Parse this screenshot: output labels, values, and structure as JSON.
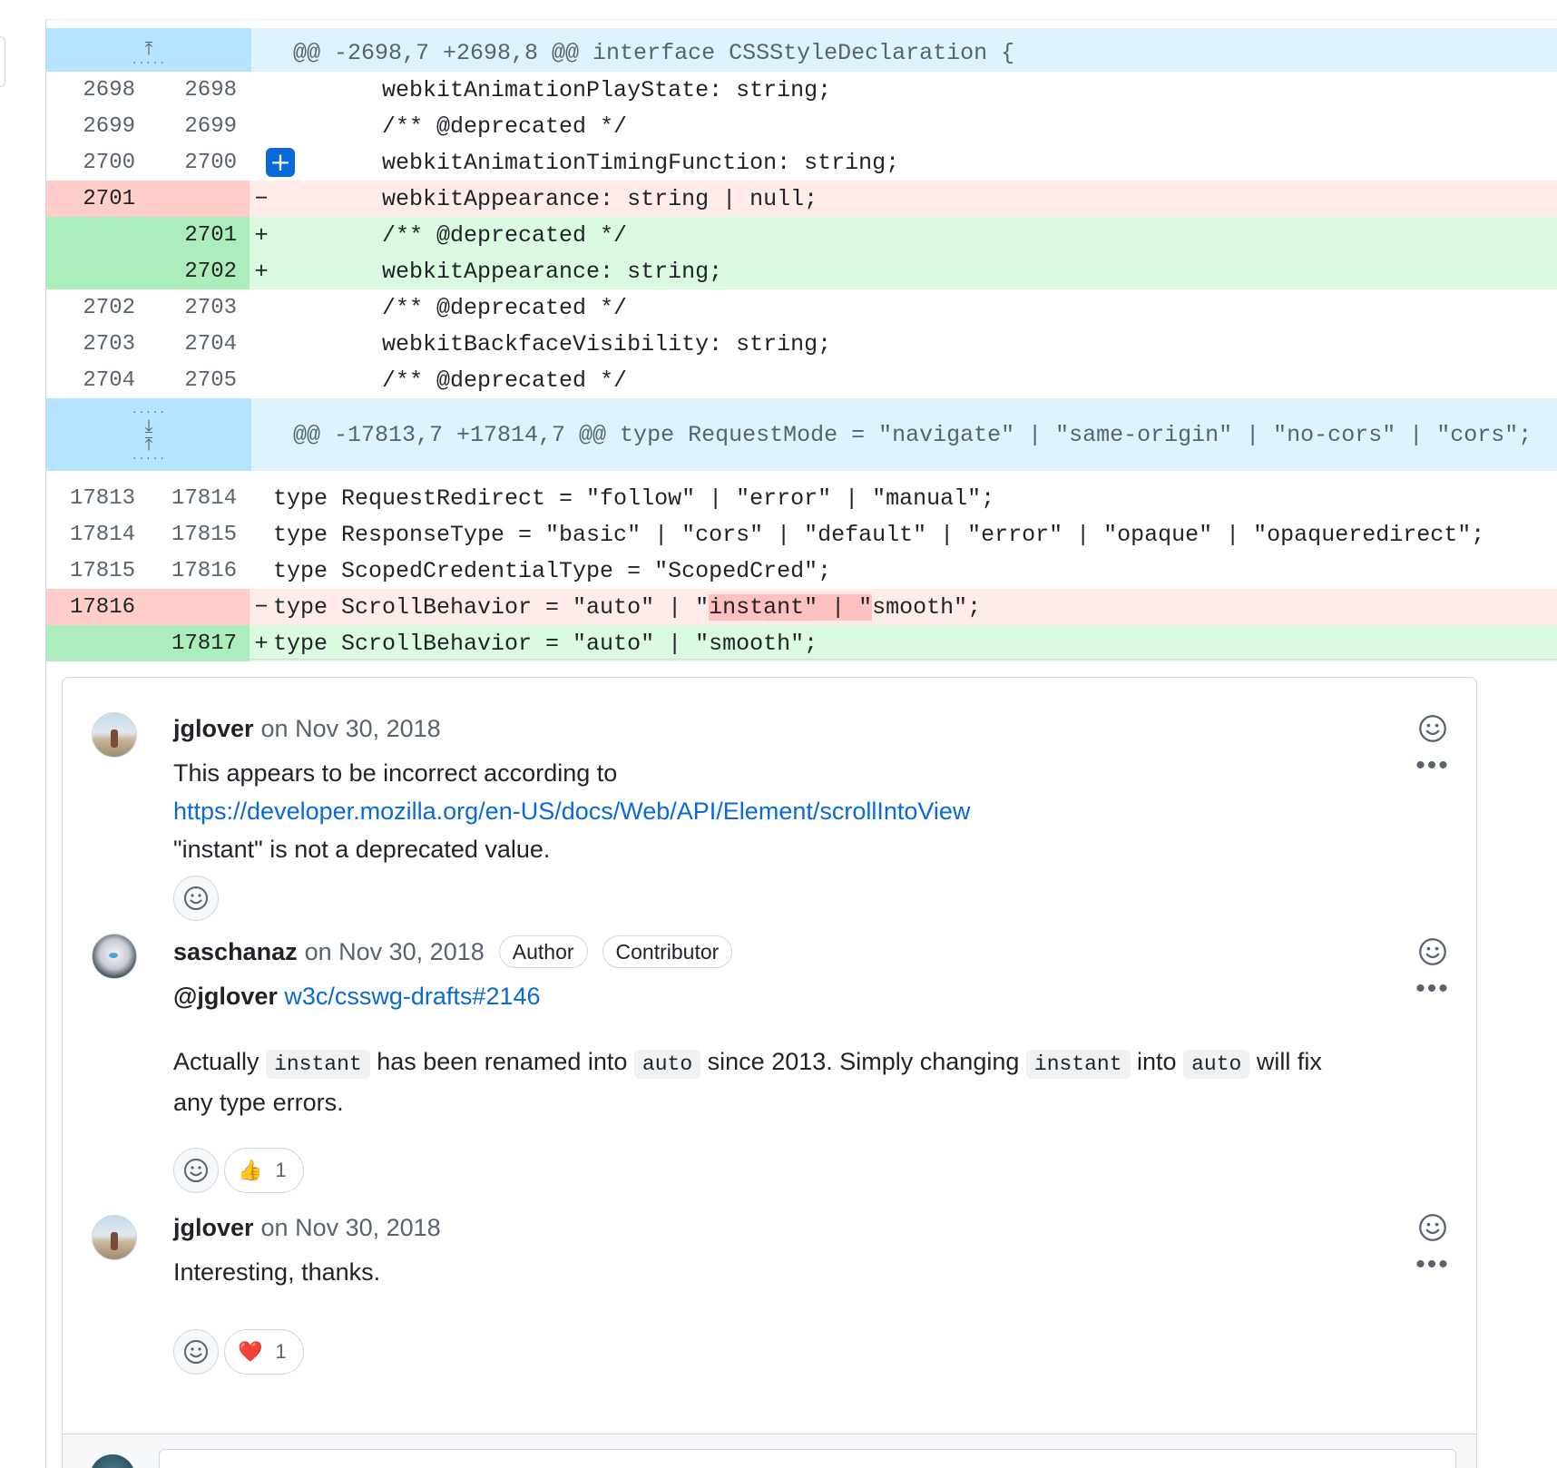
{
  "diff": {
    "hunk1": {
      "header": "@@ -2698,7 +2698,8 @@ interface CSSStyleDeclaration {"
    },
    "rows1": [
      {
        "type": "ctx",
        "old": "2698",
        "new": "2698",
        "sign": "",
        "code": "        webkitAnimationPlayState: string;"
      },
      {
        "type": "ctx",
        "old": "2699",
        "new": "2699",
        "sign": "",
        "code": "        /** @deprecated */"
      },
      {
        "type": "ctx",
        "old": "2700",
        "new": "2700",
        "sign": "",
        "code": "        webkitAnimationTimingFunction: string;"
      },
      {
        "type": "del",
        "old": "2701",
        "new": "",
        "sign": "−",
        "code": "        webkitAppearance: string | null;"
      },
      {
        "type": "add",
        "old": "",
        "new": "2701",
        "sign": "+",
        "code": "        /** @deprecated */"
      },
      {
        "type": "add",
        "old": "",
        "new": "2702",
        "sign": "+",
        "code": "        webkitAppearance: string;"
      },
      {
        "type": "ctx",
        "old": "2702",
        "new": "2703",
        "sign": "",
        "code": "        /** @deprecated */"
      },
      {
        "type": "ctx",
        "old": "2703",
        "new": "2704",
        "sign": "",
        "code": "        webkitBackfaceVisibility: string;"
      },
      {
        "type": "ctx",
        "old": "2704",
        "new": "2705",
        "sign": "",
        "code": "        /** @deprecated */"
      }
    ],
    "hunk2": {
      "header": "@@ -17813,7 +17814,7 @@ type RequestMode = \"navigate\" | \"same-origin\" | \"no-cors\" | \"cors\";"
    },
    "rows2": [
      {
        "type": "ctx",
        "old": "17813",
        "new": "17814",
        "sign": "",
        "code": "type RequestRedirect = \"follow\" | \"error\" | \"manual\";"
      },
      {
        "type": "ctx",
        "old": "17814",
        "new": "17815",
        "sign": "",
        "code": "type ResponseType = \"basic\" | \"cors\" | \"default\" | \"error\" | \"opaque\" | \"opaqueredirect\";"
      },
      {
        "type": "ctx",
        "old": "17815",
        "new": "17816",
        "sign": "",
        "code": "type ScopedCredentialType = \"ScopedCred\";"
      }
    ],
    "del_row": {
      "old": "17816",
      "sign": "−",
      "code_before": "type ScrollBehavior = \"auto\" | \"",
      "code_highlight": "instant\" | \"",
      "code_after": "smooth\";"
    },
    "add_row": {
      "new": "17817",
      "sign": "+",
      "code": "type ScrollBehavior = \"auto\" | \"smooth\";"
    }
  },
  "comments": [
    {
      "author": "jglover",
      "date": "on Nov 30, 2018",
      "line1": "This appears to be incorrect according to",
      "link": "https://developer.mozilla.org/en-US/docs/Web/API/Element/scrollIntoView",
      "line3": "\"instant\" is not a deprecated value."
    },
    {
      "author": "saschanaz",
      "date": "on Nov 30, 2018",
      "badge_author": "Author",
      "badge_contributor": "Contributor",
      "mention": "@jglover",
      "ref_link": "w3c/csswg-drafts#2146",
      "p_actually": "Actually",
      "code_instant": "instant",
      "p_renamed": "has been renamed into",
      "code_auto": "auto",
      "p_since": "since 2013. Simply changing",
      "p_into": "into",
      "p_willfix": "will fix",
      "p_line2": "any type errors.",
      "reaction_count": "1"
    },
    {
      "author": "jglover",
      "date": "on Nov 30, 2018",
      "text": "Interesting, thanks.",
      "reaction_count": "1"
    }
  ],
  "icons": {
    "smiley": "smiley-icon",
    "kebab": "kebab-horizontal-icon",
    "thumbsup": "👍",
    "heart": "❤️",
    "plus": "+",
    "expand_up": "⤒",
    "expand_down": "⤓"
  },
  "colors": {
    "link": "#0969da",
    "hunk_bg": "#ddf4ff",
    "del_bg": "#ffebe9",
    "add_bg": "#dafbe1"
  }
}
